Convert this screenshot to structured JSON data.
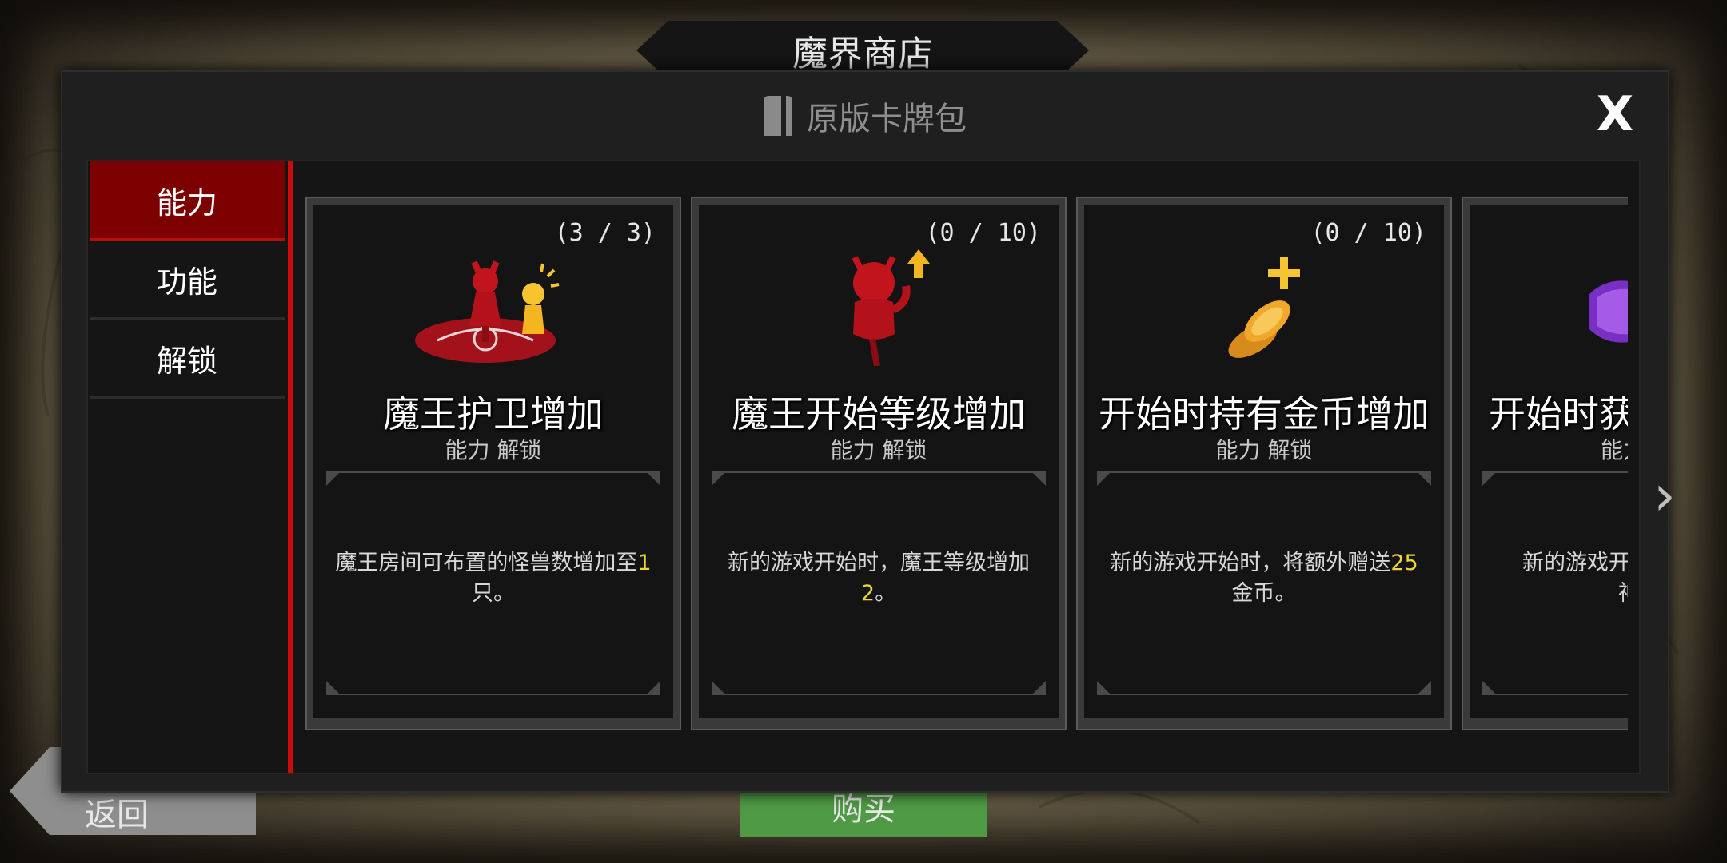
{
  "shop_title": "魔界商店",
  "back_label": "返回",
  "buy_label": "购买",
  "modal": {
    "title": "原版卡牌包",
    "close_label": "X"
  },
  "sidebar": {
    "tabs": [
      {
        "label": "能力",
        "active": true
      },
      {
        "label": "功能",
        "active": false
      },
      {
        "label": "解锁",
        "active": false
      }
    ]
  },
  "cards": [
    {
      "count": "(3 / 3)",
      "title": "魔王护卫增加",
      "tags": "能力 解锁",
      "desc_pre": "魔王房间可布置的怪兽数增加至",
      "desc_hl": "1",
      "desc_post": "只。",
      "icon": "demon-guard-icon"
    },
    {
      "count": "(0 / 10)",
      "title": "魔王开始等级增加",
      "tags": "能力 解锁",
      "desc_pre": "新的游戏开始时，魔王等级增加",
      "desc_hl": "2",
      "desc_post": "。",
      "icon": "demon-level-up-icon"
    },
    {
      "count": "(0 / 10)",
      "title": "开始时持有金币增加",
      "tags": "能力 解锁",
      "desc_pre": "新的游戏开始时，将额外赠送",
      "desc_hl": "25",
      "desc_post": "金币。",
      "icon": "gold-coins-plus-icon"
    },
    {
      "count": "",
      "title": "开始时获",
      "tags": "能力",
      "desc_pre": "新的游戏开始",
      "desc_hl": "",
      "desc_post": "神器",
      "icon": "purple-artifact-icon"
    }
  ],
  "colors": {
    "active_tab": "#7d0101",
    "divider": "#cc0b0b",
    "highlight": "#f1d534",
    "buy_button": "#4f9a44"
  }
}
